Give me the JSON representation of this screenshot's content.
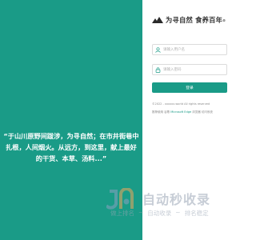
{
  "brand": {
    "logo_text": "为寻自然 食养百年",
    "logo_mark": "®",
    "icon": "mountain-logo-icon"
  },
  "quote": {
    "text": "“于山川原野间跋涉，为寻自然；在市井街巷中扎根，人间烟火。从远方，到这里，献上最好的干货、本草、汤料...”"
  },
  "login_form": {
    "username_placeholder": "请输入用户名",
    "password_placeholder": "请输入密码",
    "submit_label": "登录",
    "user_icon": "user-icon",
    "lock_icon": "lock-icon"
  },
  "footer": {
    "copyright": "©2022 - xxxxxx.world All rights reserved",
    "browser_hint_prefix": "推荐使用 谷歌",
    "browser_hint_link": "Microsoft Edge",
    "browser_hint_suffix": "浏览器 访问系统"
  },
  "watermark": {
    "title": "自动秒收录",
    "subtitle_items": [
      "做上排名",
      "自动收录",
      "排名稳定"
    ],
    "separator": "~",
    "logo": "jn-logo-icon"
  },
  "colors": {
    "primary": "#1a9b87",
    "text_dark": "#333333",
    "text_muted": "#888888",
    "border": "#dcdcdc"
  }
}
